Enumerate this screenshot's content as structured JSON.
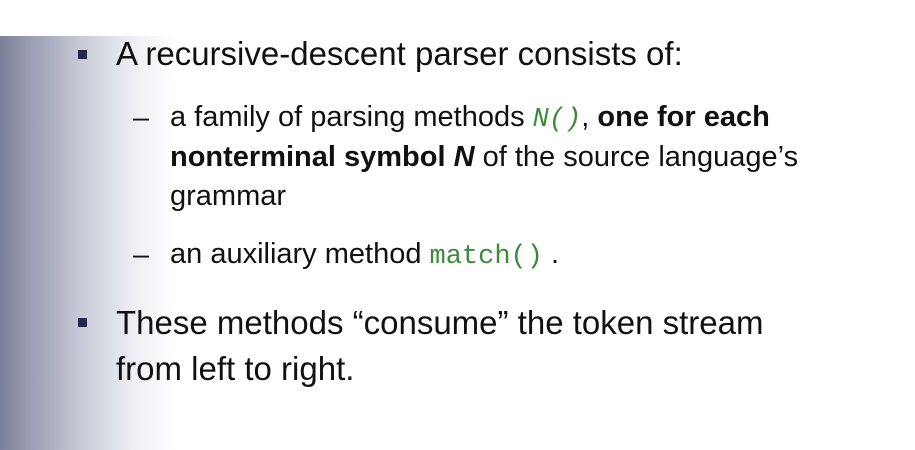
{
  "slide": {
    "bullet1": {
      "text": "A recursive-descent parser consists of:"
    },
    "sub1": {
      "part1": "a family of parsing methods ",
      "code": "N()",
      "part2": ", ",
      "bold1": "one for each",
      "bold2": "nonterminal symbol ",
      "bold_italic": "N",
      "part3": " of the source language’s",
      "line3": "grammar"
    },
    "sub2": {
      "part1": "an auxiliary method ",
      "code": "match()",
      "part2": " ."
    },
    "bullet2": {
      "line1": "These methods “consume” the token stream",
      "line2": "from left to right."
    },
    "dash_symbol": "–",
    "colors": {
      "bullet": "#22264a",
      "code": "#3d8a3d",
      "text": "#111111"
    }
  }
}
